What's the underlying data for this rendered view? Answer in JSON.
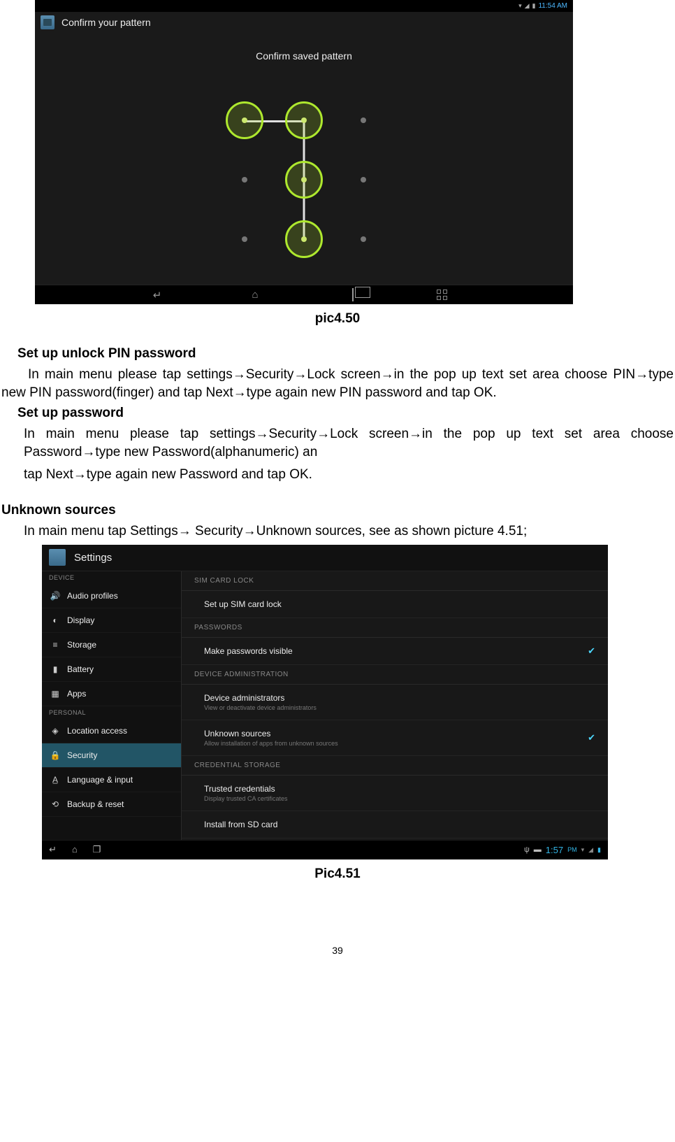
{
  "screenshot1": {
    "status_time": "11:54 AM",
    "title": "Confirm your pattern",
    "content_text": "Confirm saved pattern"
  },
  "caption1": "pic4.50",
  "section1_title": "Set up unlock PIN password",
  "section1_para": "In main menu please tap settings→Security→Lock screen→in the pop up text set area choose PIN→type new PIN password(finger) and tap Next→type again new PIN password and tap OK.",
  "section2_title": "Set up password",
  "section2_para1": "In main menu please tap settings→Security→Lock screen→in the pop up text set area choose Password→type new Password(alphanumeric) an",
  "section2_para2": "tap Next→type again new Password and tap OK.",
  "unknown_heading": "Unknown sources",
  "unknown_para": "In main menu tap Settings→ Security→Unknown sources, see as shown picture 4.51;",
  "screenshot2": {
    "title": "Settings",
    "sidebar": {
      "device_header": "DEVICE",
      "personal_header": "PERSONAL",
      "items_device": [
        {
          "icon": "speaker",
          "label": "Audio profiles"
        },
        {
          "icon": "display",
          "label": "Display"
        },
        {
          "icon": "storage",
          "label": "Storage"
        },
        {
          "icon": "battery",
          "label": "Battery"
        },
        {
          "icon": "apps",
          "label": "Apps"
        }
      ],
      "items_personal": [
        {
          "icon": "location",
          "label": "Location access"
        },
        {
          "icon": "lock",
          "label": "Security"
        },
        {
          "icon": "lang",
          "label": "Language & input"
        },
        {
          "icon": "backup",
          "label": "Backup & reset"
        }
      ]
    },
    "panel": {
      "h1": "SIM CARD LOCK",
      "i1": "Set up SIM card lock",
      "h2": "PASSWORDS",
      "i2": "Make passwords visible",
      "h3": "DEVICE ADMINISTRATION",
      "i3": "Device administrators",
      "i3sub": "View or deactivate device administrators",
      "i4": "Unknown sources",
      "i4sub": "Allow installation of apps from unknown sources",
      "h4": "CREDENTIAL STORAGE",
      "i5": "Trusted credentials",
      "i5sub": "Display trusted CA certificates",
      "i6": "Install from SD card"
    },
    "navbar_time1": "1:57",
    "navbar_time2": "PM"
  },
  "caption2": "Pic4.51",
  "page_number": "39"
}
